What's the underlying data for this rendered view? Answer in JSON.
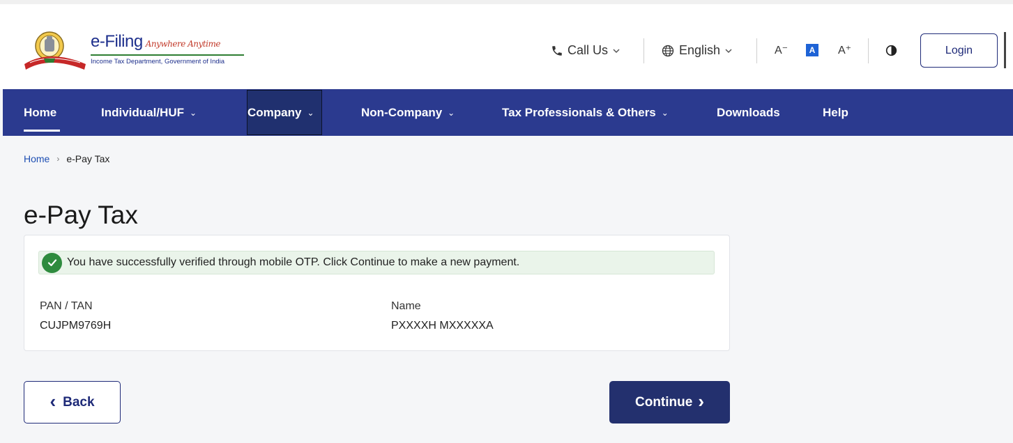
{
  "header": {
    "brand_title": "e-Filing",
    "brand_tagline": "Anywhere Anytime",
    "brand_subtitle": "Income Tax Department, Government of India",
    "call_us": "Call Us",
    "language": "English",
    "font_decrease": "A⁻",
    "font_default": "A",
    "font_increase": "A⁺",
    "login_label": "Login",
    "icons": [
      "phone-icon",
      "globe-icon",
      "contrast-icon",
      "chevron-down-icon"
    ]
  },
  "nav": {
    "items": [
      {
        "label": "Home"
      },
      {
        "label": "Individual/HUF"
      },
      {
        "label": "Company"
      },
      {
        "label": "Non-Company"
      },
      {
        "label": "Tax Professionals & Others"
      },
      {
        "label": "Downloads"
      },
      {
        "label": "Help"
      }
    ]
  },
  "breadcrumb": {
    "home": "Home",
    "separator": "›",
    "current": "e-Pay Tax"
  },
  "page_title": "e-Pay Tax",
  "card": {
    "alert_text": "You have successfully verified through mobile OTP. Click Continue to make a new payment.",
    "pan_label": "PAN / TAN",
    "pan_value": "CUJPM9769H",
    "name_label": "Name",
    "name_value": "PXXXXH MXXXXXA"
  },
  "actions": {
    "back_label": "Back",
    "back_chevron": "‹",
    "continue_label": "Continue",
    "continue_chevron": "›"
  },
  "colors": {
    "nav_bg": "#2b3a8f",
    "primary_button": "#23306e",
    "success_green": "#2e8b3e",
    "alert_bg": "#eaf4ea",
    "link_blue": "#1e4fb3"
  }
}
